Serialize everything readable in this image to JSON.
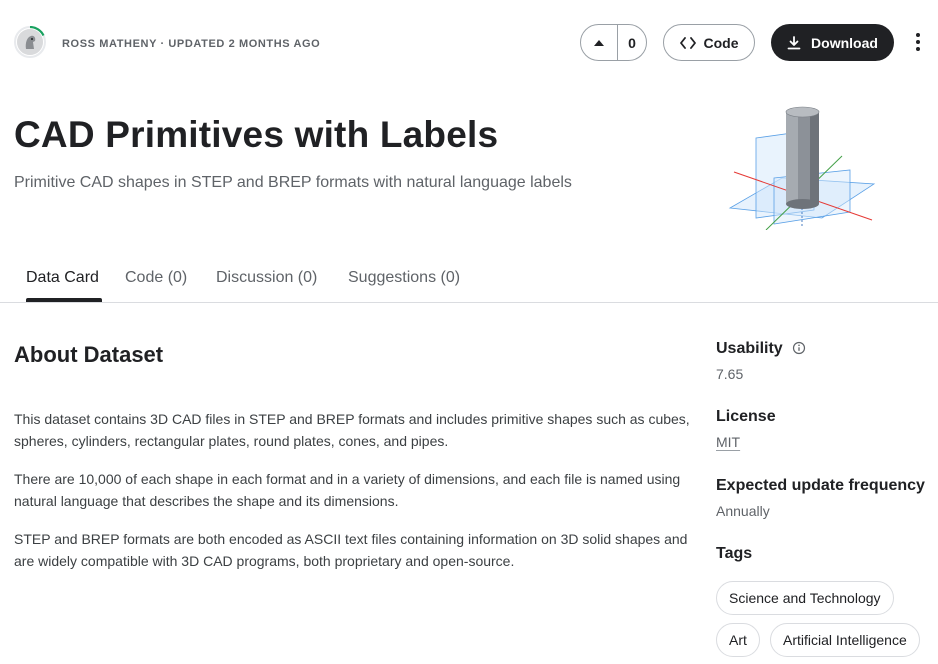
{
  "header": {
    "author": "ROSS MATHENY",
    "separator": "·",
    "updated": "UPDATED 2 MONTHS AGO",
    "upvote_count": "0",
    "code_button": "Code",
    "download_button": "Download"
  },
  "dataset": {
    "title": "CAD Primitives with Labels",
    "subtitle": "Primitive CAD shapes in STEP and BREP formats with natural language labels"
  },
  "tabs": [
    {
      "label": "Data Card",
      "active": true
    },
    {
      "label": "Code (0)",
      "active": false
    },
    {
      "label": "Discussion (0)",
      "active": false
    },
    {
      "label": "Suggestions (0)",
      "active": false
    }
  ],
  "about": {
    "heading": "About Dataset",
    "paragraphs": [
      "This dataset contains 3D CAD files in STEP and BREP formats and includes primitive shapes such as cubes, spheres, cylinders, rectangular plates, round plates, cones, and pipes.",
      "There are 10,000 of each shape in each format and in a variety of dimensions, and each file is named using natural language that describes the shape and its dimensions.",
      "STEP and BREP formats are both encoded as ASCII text files containing information on 3D solid shapes and are widely compatible with 3D CAD programs, both proprietary and open-source."
    ]
  },
  "sidebar": {
    "usability_label": "Usability",
    "usability_value": "7.65",
    "license_label": "License",
    "license_value": "MIT",
    "frequency_label": "Expected update frequency",
    "frequency_value": "Annually",
    "tags_label": "Tags",
    "tags": [
      "Science and Technology",
      "Art",
      "Artificial Intelligence"
    ]
  },
  "icons": {
    "upvote": "caret-up-icon",
    "code": "code-brackets-icon",
    "download": "download-icon",
    "more": "more-vertical-icon",
    "info": "info-circle-icon"
  },
  "colors": {
    "primary_dark": "#202124",
    "muted_text": "#5f6368",
    "border": "#dadce0",
    "ring_green": "#20beff"
  }
}
